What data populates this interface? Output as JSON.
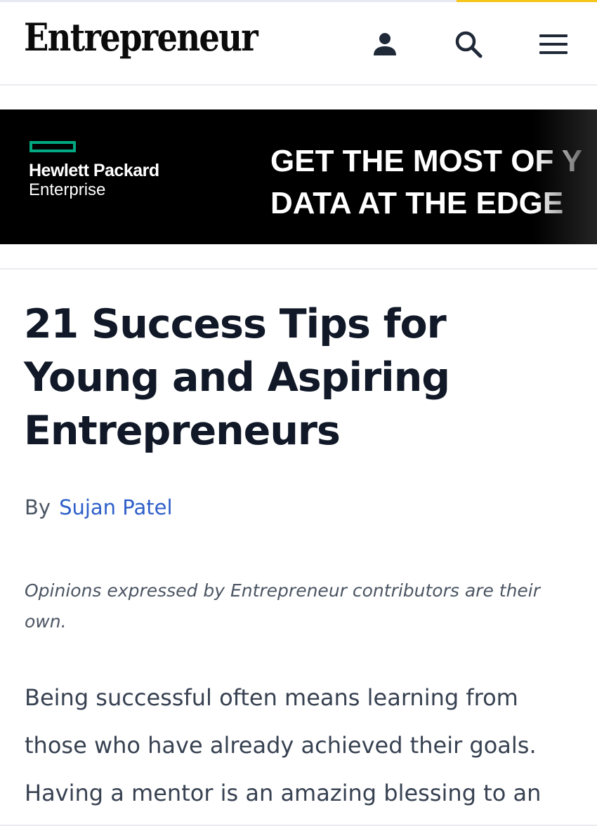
{
  "header": {
    "logo": "Entrepreneur",
    "account_icon": "person-icon",
    "search_icon": "search-icon",
    "menu_icon": "hamburger-menu-icon"
  },
  "ad": {
    "brand_line1": "Hewlett Packard",
    "brand_line2": "Enterprise",
    "headline_line1": "GET THE MOST OF Y",
    "headline_line2": "DATA AT THE EDGE",
    "brand_color": "#01a982"
  },
  "article": {
    "title": "21 Success Tips for Young and Aspiring Entrepreneurs",
    "byline_prefix": "By",
    "author": "Sujan Patel",
    "disclaimer": "Opinions expressed by Entrepreneur contributors are their own.",
    "body": "Being successful often means learning from those who have already achieved their goals. Having a mentor is an amazing blessing to an"
  },
  "colors": {
    "accent_yellow": "#f5c518",
    "link_blue": "#2f5fc9",
    "title_text": "#111827"
  }
}
